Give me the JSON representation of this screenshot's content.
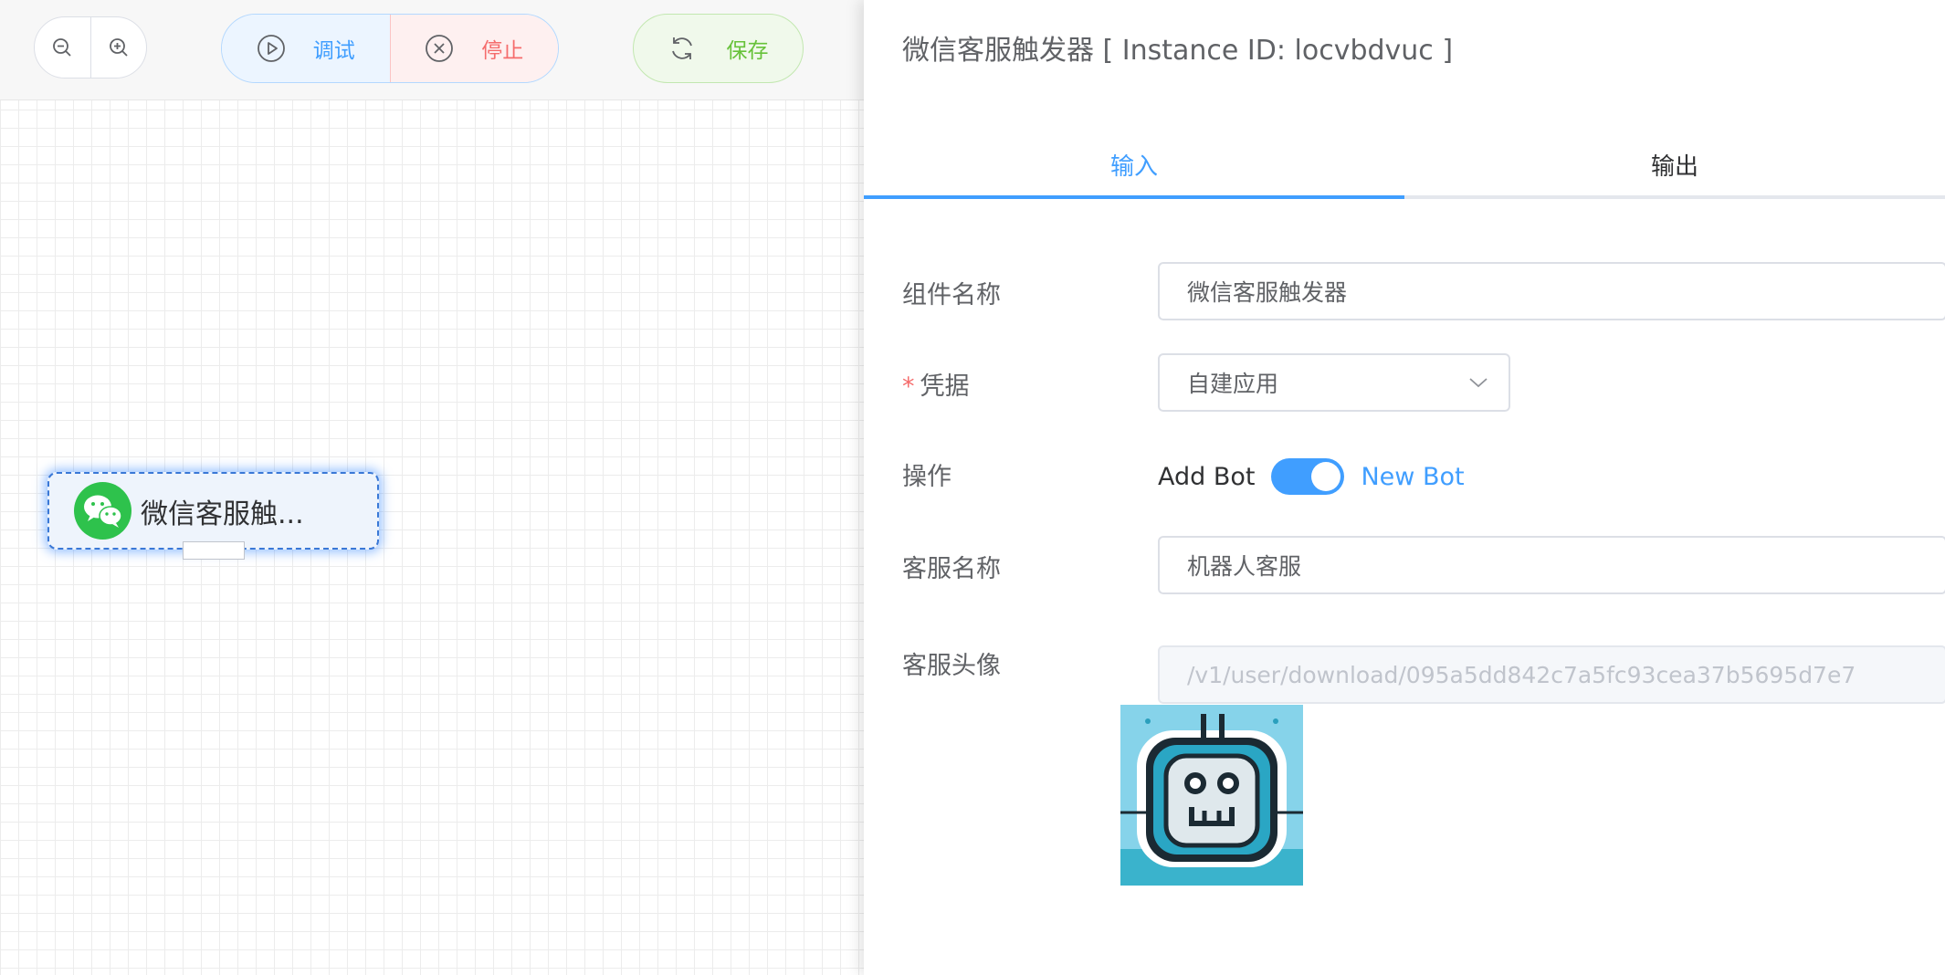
{
  "toolbar": {
    "zoom_out_icon": "zoom-out-icon",
    "zoom_in_icon": "zoom-in-icon",
    "debug_label": "调试",
    "stop_label": "停止",
    "save_label": "保存"
  },
  "canvas": {
    "node_label": "微信客服触..."
  },
  "panel": {
    "title": "微信客服触发器 [ Instance ID: locvbdvuc ]",
    "tabs": [
      {
        "label": "输入",
        "active": true
      },
      {
        "label": "输出",
        "active": false
      }
    ],
    "fields": {
      "component_name": {
        "label": "组件名称",
        "value": "微信客服触发器"
      },
      "credential": {
        "label": "凭据",
        "value": "自建应用",
        "required": "*"
      },
      "operation": {
        "label": "操作",
        "off_text": "Add Bot",
        "on_text": "New Bot",
        "state": "on"
      },
      "service_name": {
        "label": "客服名称",
        "value": "机器人客服"
      },
      "service_avatar": {
        "label": "客服头像",
        "placeholder": "/v1/user/download/095a5dd842c7a5fc93cea37b5695d7e7"
      }
    }
  },
  "colors": {
    "primary": "#409eff",
    "danger": "#f56c6c",
    "success": "#67c23a",
    "wechat_green": "#2ec24c"
  }
}
